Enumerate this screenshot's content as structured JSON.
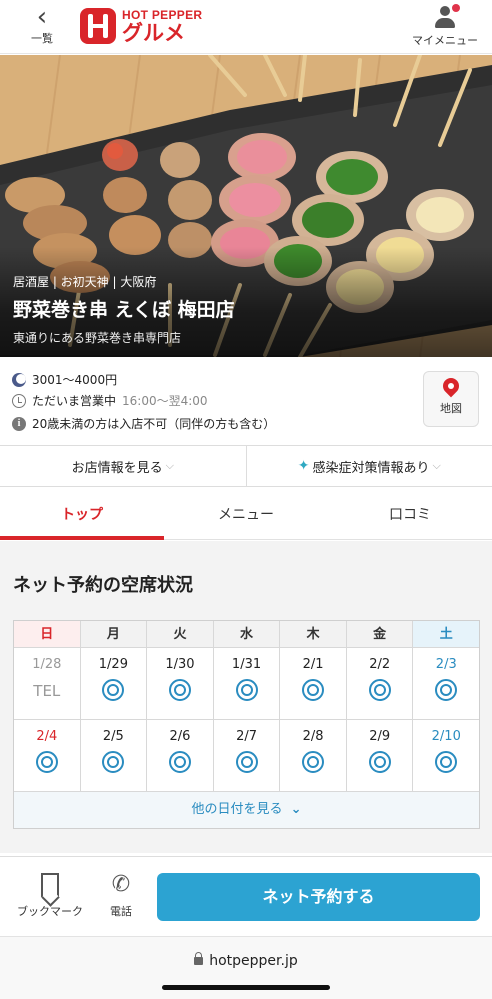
{
  "header": {
    "back_label": "一覧",
    "logo_top": "HOT PEPPER",
    "logo_bottom": "グルメ",
    "mymenu_label": "マイメニュー"
  },
  "hero": {
    "category": "居酒屋 | お初天神 | 大阪府",
    "shop_name": "野菜巻き串 えくぼ 梅田店",
    "catch": "東通りにある野菜巻き串専門店"
  },
  "info": {
    "budget": "3001～4000円",
    "open_status": "ただいま営業中",
    "hours": "16:00～翌4:00",
    "notice": "20歳未満の方は入店不可（同伴の方も含む）",
    "map_label": "地図"
  },
  "buttons": {
    "shop_info": "お店情報を見る",
    "infection": "感染症対策情報あり"
  },
  "tabs": [
    {
      "label": "トップ",
      "active": true
    },
    {
      "label": "メニュー",
      "active": false
    },
    {
      "label": "口コミ",
      "active": false
    }
  ],
  "reservation": {
    "title": "ネット予約の空席状況",
    "weekdays": [
      "日",
      "月",
      "火",
      "水",
      "木",
      "金",
      "土"
    ],
    "weeks": [
      [
        {
          "date": "1/28",
          "status": "TEL",
          "kind": "past"
        },
        {
          "date": "1/29",
          "status": "◎",
          "kind": "normal"
        },
        {
          "date": "1/30",
          "status": "◎",
          "kind": "normal"
        },
        {
          "date": "1/31",
          "status": "◎",
          "kind": "normal"
        },
        {
          "date": "2/1",
          "status": "◎",
          "kind": "normal"
        },
        {
          "date": "2/2",
          "status": "◎",
          "kind": "normal"
        },
        {
          "date": "2/3",
          "status": "◎",
          "kind": "sat"
        }
      ],
      [
        {
          "date": "2/4",
          "status": "◎",
          "kind": "sun"
        },
        {
          "date": "2/5",
          "status": "◎",
          "kind": "normal"
        },
        {
          "date": "2/6",
          "status": "◎",
          "kind": "normal"
        },
        {
          "date": "2/7",
          "status": "◎",
          "kind": "normal"
        },
        {
          "date": "2/8",
          "status": "◎",
          "kind": "normal"
        },
        {
          "date": "2/9",
          "status": "◎",
          "kind": "normal"
        },
        {
          "date": "2/10",
          "status": "◎",
          "kind": "sat"
        }
      ]
    ],
    "more_label": "他の日付を見る"
  },
  "bottom": {
    "bookmark": "ブックマーク",
    "phone": "電話",
    "reserve": "ネット予約する"
  },
  "browser": {
    "url": "hotpepper.jp"
  },
  "colors": {
    "brand_red": "#d9252a",
    "accent_blue": "#2ca3d2",
    "saturday_blue": "#2a8cc0"
  }
}
